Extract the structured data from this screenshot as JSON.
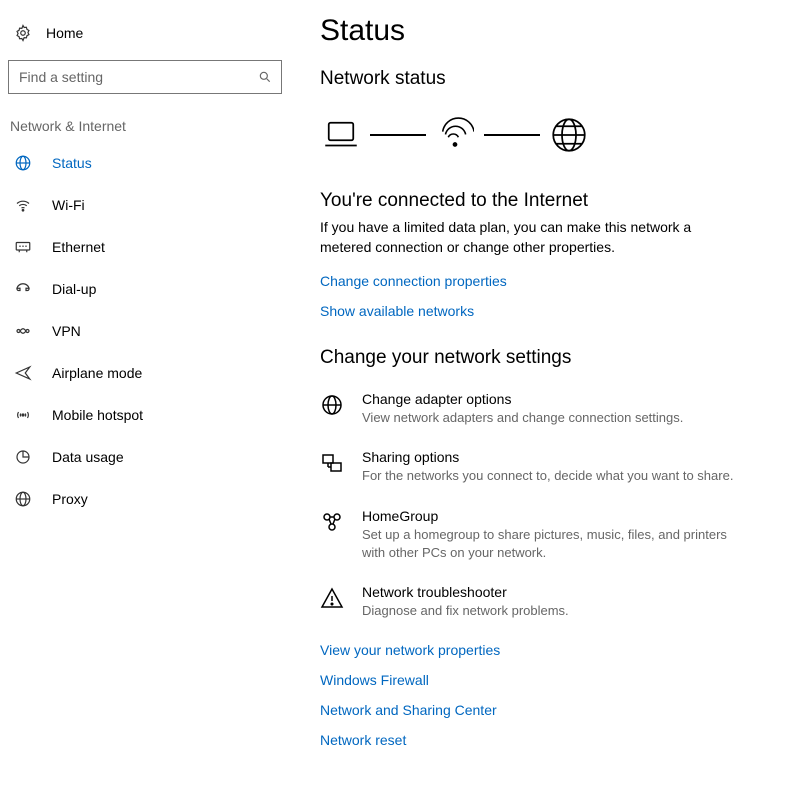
{
  "sidebar": {
    "home_label": "Home",
    "search_placeholder": "Find a setting",
    "section_title": "Network & Internet",
    "items": [
      {
        "label": "Status",
        "active": true
      },
      {
        "label": "Wi-Fi"
      },
      {
        "label": "Ethernet"
      },
      {
        "label": "Dial-up"
      },
      {
        "label": "VPN"
      },
      {
        "label": "Airplane mode"
      },
      {
        "label": "Mobile hotspot"
      },
      {
        "label": "Data usage"
      },
      {
        "label": "Proxy"
      }
    ]
  },
  "page": {
    "title": "Status",
    "network_status_heading": "Network status",
    "connected_heading": "You're connected to the Internet",
    "connected_body": "If you have a limited data plan, you can make this network a metered connection or change other properties.",
    "link_change_conn": "Change connection properties",
    "link_show_networks": "Show available networks",
    "change_settings_heading": "Change your network settings",
    "settings": [
      {
        "title": "Change adapter options",
        "desc": "View network adapters and change connection settings."
      },
      {
        "title": "Sharing options",
        "desc": "For the networks you connect to, decide what you want to share."
      },
      {
        "title": "HomeGroup",
        "desc": "Set up a homegroup to share pictures, music, files, and printers with other PCs on your network."
      },
      {
        "title": "Network troubleshooter",
        "desc": "Diagnose and fix network problems."
      }
    ],
    "extra_links": [
      "View your network properties",
      "Windows Firewall",
      "Network and Sharing Center",
      "Network reset"
    ]
  }
}
